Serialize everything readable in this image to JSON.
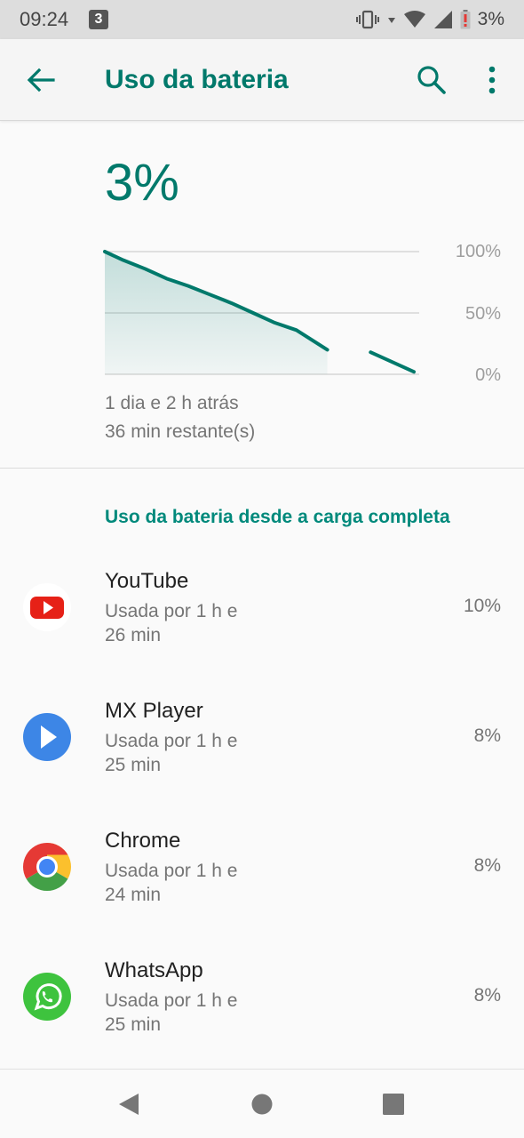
{
  "status_bar": {
    "time": "09:24",
    "notification_badge": "3",
    "battery_text": "3%",
    "icons": [
      "vibrate-icon",
      "wifi-icon",
      "signal-icon",
      "battery-low-icon"
    ]
  },
  "app_bar": {
    "title": "Uso da bateria",
    "icons": [
      "back-arrow-icon",
      "search-icon",
      "more-vert-icon"
    ]
  },
  "summary": {
    "battery_percent": "3%",
    "time_ago": "1 dia e 2 h atrás",
    "remaining": "36 min restante(s)"
  },
  "chart_data": {
    "type": "area",
    "x": [
      0,
      0.06,
      0.13,
      0.2,
      0.27,
      0.34,
      0.41,
      0.48,
      0.55,
      0.62,
      0.72,
      0.76,
      0.8,
      0.86,
      0.93,
      1.0
    ],
    "series": [
      {
        "values": [
          100,
          93,
          86,
          78,
          72,
          65,
          58,
          50,
          42,
          36,
          20,
          null,
          null,
          18,
          10,
          2
        ]
      }
    ],
    "y_ticks": [
      "100%",
      "50%",
      "0%"
    ],
    "ylim": [
      0,
      100
    ],
    "accent_color": "#00796b"
  },
  "section": {
    "title": "Uso da bateria desde a carga completa"
  },
  "apps": [
    {
      "name": "YouTube",
      "usage_line1": "Usada por 1 h e",
      "usage_line2": "26 min",
      "percent": "10%",
      "icon": "youtube-icon"
    },
    {
      "name": "MX Player",
      "usage_line1": "Usada por 1 h e",
      "usage_line2": "25 min",
      "percent": "8%",
      "icon": "mx-player-icon"
    },
    {
      "name": "Chrome",
      "usage_line1": "Usada por 1 h e",
      "usage_line2": "24 min",
      "percent": "8%",
      "icon": "chrome-icon"
    },
    {
      "name": "WhatsApp",
      "usage_line1": "Usada por 1 h e",
      "usage_line2": "25 min",
      "percent": "8%",
      "icon": "whatsapp-icon"
    }
  ],
  "nav_bar": {
    "icons": [
      "back-triangle-icon",
      "home-circle-icon",
      "recents-square-icon"
    ]
  },
  "colors": {
    "accent": "#00796b",
    "status_bar_bg": "#dddddd",
    "battery_warning": "#e53935"
  }
}
